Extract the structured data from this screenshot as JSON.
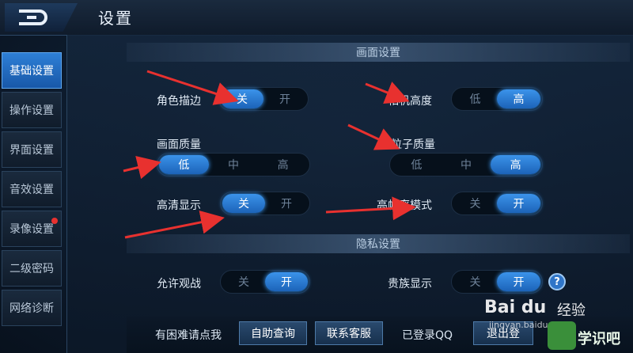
{
  "header": {
    "title": "设置"
  },
  "sidebar": {
    "items": [
      {
        "label": "基础设置"
      },
      {
        "label": "操作设置"
      },
      {
        "label": "界面设置"
      },
      {
        "label": "音效设置"
      },
      {
        "label": "录像设置"
      },
      {
        "label": "二级密码"
      },
      {
        "label": "网络诊断"
      }
    ]
  },
  "sections": {
    "display": "画面设置",
    "privacy": "隐私设置"
  },
  "settings": {
    "outline": {
      "label": "角色描边",
      "options": [
        "关",
        "开"
      ],
      "selected": "关"
    },
    "camera": {
      "label": "相机高度",
      "options": [
        "低",
        "高"
      ],
      "selected": "高"
    },
    "quality": {
      "label": "画面质量",
      "options": [
        "低",
        "中",
        "高"
      ],
      "selected": "低"
    },
    "particle": {
      "label": "粒子质量",
      "options": [
        "低",
        "中",
        "高"
      ],
      "selected": "高"
    },
    "hd": {
      "label": "高清显示",
      "options": [
        "关",
        "开"
      ],
      "selected": "关"
    },
    "highfps": {
      "label": "高帧率模式",
      "options": [
        "关",
        "开"
      ],
      "selected": "开"
    },
    "spectate": {
      "label": "允许观战",
      "options": [
        "关",
        "开"
      ],
      "selected": "开"
    },
    "noble": {
      "label": "贵族显示",
      "options": [
        "关",
        "开"
      ],
      "selected": "开"
    }
  },
  "help": {
    "glyph": "?"
  },
  "footer": {
    "trouble": "有困难请点我",
    "self_help": "自助查询",
    "contact": "联系客服",
    "logged_in": "已登录QQ",
    "logout": "退出登"
  },
  "watermark": {
    "brand": "Bai du",
    "brand_sub": "经验",
    "site": "jingyan.baidu.com",
    "extra": "学识吧"
  },
  "colors": {
    "accent": "#2f86e0",
    "annotation": "#e8312f"
  }
}
